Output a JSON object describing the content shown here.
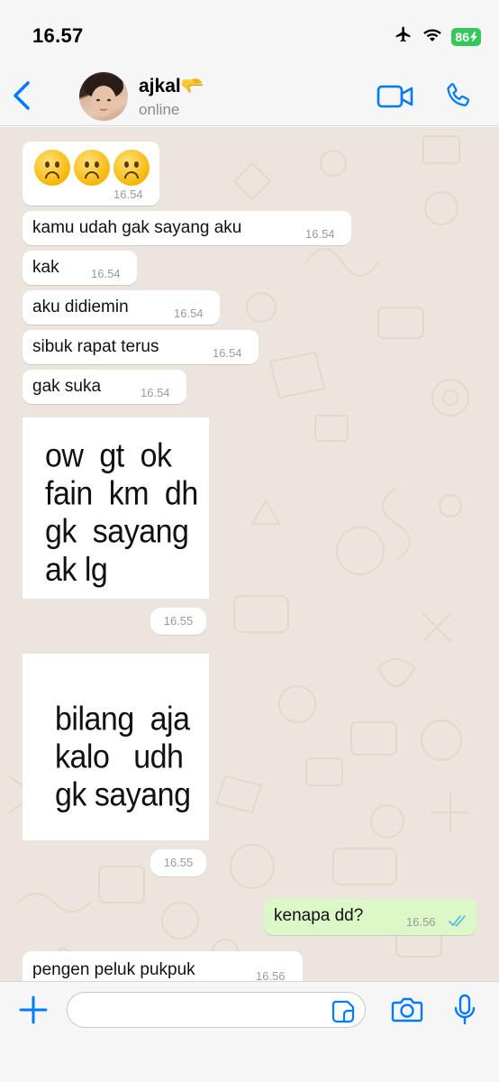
{
  "status_bar": {
    "time": "16.57",
    "battery": "86"
  },
  "header": {
    "contact_name": "ajkal🫳",
    "contact_status": "online"
  },
  "messages": [
    {
      "kind": "emoji",
      "text": "☹️☹️☹️",
      "time": "16.54"
    },
    {
      "kind": "text",
      "text": "kamu udah gak sayang aku",
      "time": "16.54"
    },
    {
      "kind": "text",
      "text": "kak",
      "time": "16.54"
    },
    {
      "kind": "text",
      "text": "aku didiemin",
      "time": "16.54"
    },
    {
      "kind": "text",
      "text": "sibuk rapat terus",
      "time": "16.54"
    },
    {
      "kind": "text",
      "text": "gak suka",
      "time": "16.54"
    },
    {
      "kind": "image",
      "text": "ow  gt  ok\nfain  km  dh\ngk  sayang\nak lg",
      "time": "16.55"
    },
    {
      "kind": "image",
      "text": "bilang  aja\nkalo   udh\ngk sayang",
      "time": "16.55"
    },
    {
      "kind": "text",
      "direction": "outgoing",
      "text": "kenapa dd?",
      "time": "16.56",
      "read_status": "read"
    },
    {
      "kind": "text",
      "text": "pengen peluk pukpuk",
      "time": "16.56"
    }
  ],
  "input": {
    "placeholder": "",
    "value": ""
  },
  "icons": {
    "back": "chevron-left-icon",
    "video": "video-camera-icon",
    "call": "phone-icon",
    "plus": "plus-icon",
    "sticker": "sticker-icon",
    "camera": "camera-icon",
    "mic": "microphone-icon",
    "airplane": "airplane-icon",
    "wifi": "wifi-icon",
    "ticks": "double-check-icon"
  },
  "colors": {
    "accent": "#007aff",
    "outgoing_bubble": "#dcf8c6",
    "chat_background": "#ece5dd",
    "battery": "#34c759",
    "read_ticks": "#4fb6ec"
  }
}
